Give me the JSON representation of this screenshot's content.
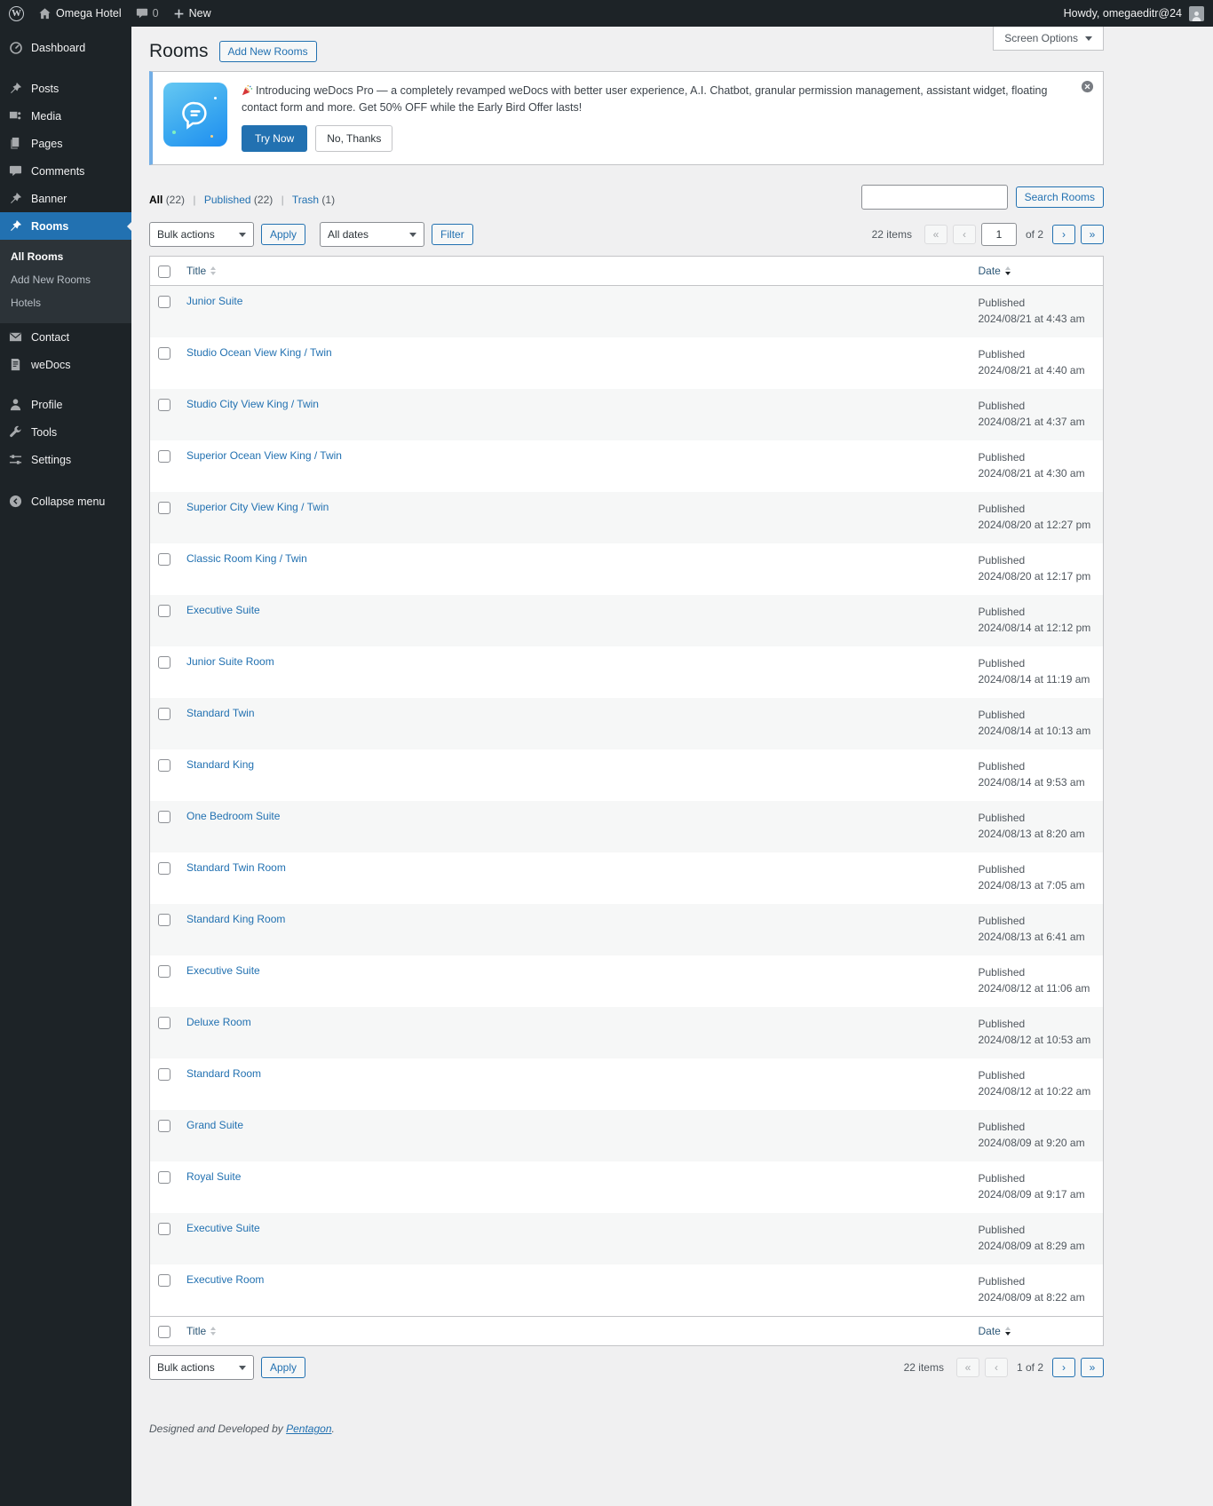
{
  "colors": {
    "accent": "#2271b1",
    "admin_bg": "#1d2327",
    "submenu_bg": "#2c3338",
    "content_bg": "#f0f0f1",
    "notice_accent": "#72aee6",
    "stripe": "#f6f7f7"
  },
  "admin_bar": {
    "site_name": "Omega Hotel",
    "comments_count": "0",
    "new_label": "New",
    "howdy": "Howdy, omegaeditr@24",
    "icons": [
      "wordpress-logo",
      "home-icon",
      "comments-bubble-icon",
      "plus-icon",
      "avatar"
    ]
  },
  "sidebar": {
    "items": [
      {
        "label": "Dashboard",
        "icon": "dashboard-gauge"
      },
      {
        "label": "Posts",
        "icon": "pushpin"
      },
      {
        "label": "Media",
        "icon": "media-camera"
      },
      {
        "label": "Pages",
        "icon": "pages-stack"
      },
      {
        "label": "Comments",
        "icon": "speech-bubble"
      },
      {
        "label": "Banner",
        "icon": "pushpin"
      },
      {
        "label": "Rooms",
        "icon": "pushpin"
      },
      {
        "label": "Contact",
        "icon": "envelope"
      },
      {
        "label": "weDocs",
        "icon": "document"
      },
      {
        "label": "Profile",
        "icon": "person"
      },
      {
        "label": "Tools",
        "icon": "wrench"
      },
      {
        "label": "Settings",
        "icon": "sliders"
      },
      {
        "label": "Collapse menu",
        "icon": "circle-arrow-left"
      }
    ],
    "rooms_submenu": [
      "All Rooms",
      "Add New Rooms",
      "Hotels"
    ],
    "active_item": "Rooms",
    "active_submenu_item": "All Rooms"
  },
  "page": {
    "heading": "Rooms",
    "add_new": "Add New Rooms",
    "screen_options": "Screen Options"
  },
  "notice": {
    "icon": "wedocs-logo-badge",
    "emoji_icon": "party-popper",
    "message": "Introducing weDocs Pro — a completely revamped weDocs with better user experience, A.I. Chatbot, granular permission management, assistant widget, floating contact form and more. Get 50% OFF while the Early Bird Offer lasts!",
    "try_now": "Try Now",
    "no_thanks": "No, Thanks",
    "dismiss": "dismiss-circle-x-icon"
  },
  "views": {
    "all_label": "All",
    "all_count": "(22)",
    "published_label": "Published",
    "published_count": "(22)",
    "trash_label": "Trash",
    "trash_count": "(1)",
    "separator": "|"
  },
  "search": {
    "button_label": "Search Rooms",
    "value": ""
  },
  "tablenav_top": {
    "bulk_actions_label": "Bulk actions",
    "apply_label": "Apply",
    "dates_label": "All dates",
    "filter_label": "Filter",
    "items_count": "22 items",
    "first": "«",
    "prev": "‹",
    "current_page": "1",
    "of_pages": "of 2",
    "next": "›",
    "last": "»"
  },
  "tablenav_bottom": {
    "bulk_actions_label": "Bulk actions",
    "apply_label": "Apply",
    "items_count": "22 items",
    "first": "«",
    "prev": "‹",
    "page_text": "1 of 2",
    "next": "›",
    "last": "»"
  },
  "table": {
    "title_col": "Title",
    "date_col": "Date",
    "rows": [
      {
        "title": "Junior Suite",
        "status": "Published",
        "date": "2024/08/21 at 4:43 am"
      },
      {
        "title": "Studio Ocean View King / Twin",
        "status": "Published",
        "date": "2024/08/21 at 4:40 am"
      },
      {
        "title": "Studio City View King / Twin",
        "status": "Published",
        "date": "2024/08/21 at 4:37 am"
      },
      {
        "title": "Superior Ocean View King / Twin",
        "status": "Published",
        "date": "2024/08/21 at 4:30 am"
      },
      {
        "title": "Superior City View King / Twin",
        "status": "Published",
        "date": "2024/08/20 at 12:27 pm"
      },
      {
        "title": "Classic Room King / Twin",
        "status": "Published",
        "date": "2024/08/20 at 12:17 pm"
      },
      {
        "title": "Executive Suite",
        "status": "Published",
        "date": "2024/08/14 at 12:12 pm"
      },
      {
        "title": "Junior Suite Room",
        "status": "Published",
        "date": "2024/08/14 at 11:19 am"
      },
      {
        "title": "Standard Twin",
        "status": "Published",
        "date": "2024/08/14 at 10:13 am"
      },
      {
        "title": "Standard King",
        "status": "Published",
        "date": "2024/08/14 at 9:53 am"
      },
      {
        "title": "One Bedroom Suite",
        "status": "Published",
        "date": "2024/08/13 at 8:20 am"
      },
      {
        "title": "Standard Twin Room",
        "status": "Published",
        "date": "2024/08/13 at 7:05 am"
      },
      {
        "title": "Standard King Room",
        "status": "Published",
        "date": "2024/08/13 at 6:41 am"
      },
      {
        "title": "Executive Suite",
        "status": "Published",
        "date": "2024/08/12 at 11:06 am"
      },
      {
        "title": "Deluxe Room",
        "status": "Published",
        "date": "2024/08/12 at 10:53 am"
      },
      {
        "title": "Standard Room",
        "status": "Published",
        "date": "2024/08/12 at 10:22 am"
      },
      {
        "title": "Grand Suite",
        "status": "Published",
        "date": "2024/08/09 at 9:20 am"
      },
      {
        "title": "Royal Suite",
        "status": "Published",
        "date": "2024/08/09 at 9:17 am"
      },
      {
        "title": "Executive Suite",
        "status": "Published",
        "date": "2024/08/09 at 8:29 am"
      },
      {
        "title": "Executive Room",
        "status": "Published",
        "date": "2024/08/09 at 8:22 am"
      }
    ]
  },
  "footer": {
    "prefix": "Designed and Developed by",
    "link_label": "Pentagon",
    "suffix": "."
  }
}
